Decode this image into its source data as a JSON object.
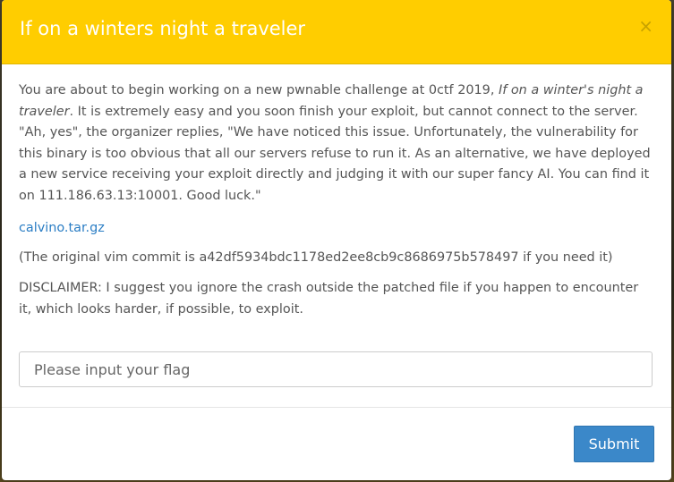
{
  "modal": {
    "title": "If on a winters night a traveler",
    "close_glyph": "×",
    "intro_before_title": "You are about to begin working on a new pwnable challenge at 0ctf 2019, ",
    "intro_title_italic": "If on a winter's night a traveler",
    "intro_after_title": ". It is extremely easy and you soon finish your exploit, but cannot connect to the server. \"Ah, yes\", the organizer replies, \"We have noticed this issue. Unfortunately, the vulnerability for this binary is too obvious that all our servers refuse to run it. As an alternative, we have deployed a new service receiving your exploit directly and judging it with our super fancy AI. You can find it on 111.186.63.13:10001. Good luck.\"",
    "attachment_link": "calvino.tar.gz",
    "commit_note": "(The original vim commit is a42df5934bdc1178ed2ee8cb9c8686975b578497 if you need it)",
    "disclaimer": "DISCLAIMER: I suggest you ignore the crash outside the patched file if you happen to encounter it, which looks harder, if possible, to exploit.",
    "flag_placeholder": "Please input your flag",
    "flag_value": "",
    "submit_label": "Submit"
  },
  "colors": {
    "header": "#ffcd00",
    "title_text": "#ffffff",
    "link": "#2a7dc4",
    "submit_button": "#3b88c9"
  },
  "icons": {
    "close": "close-icon"
  }
}
